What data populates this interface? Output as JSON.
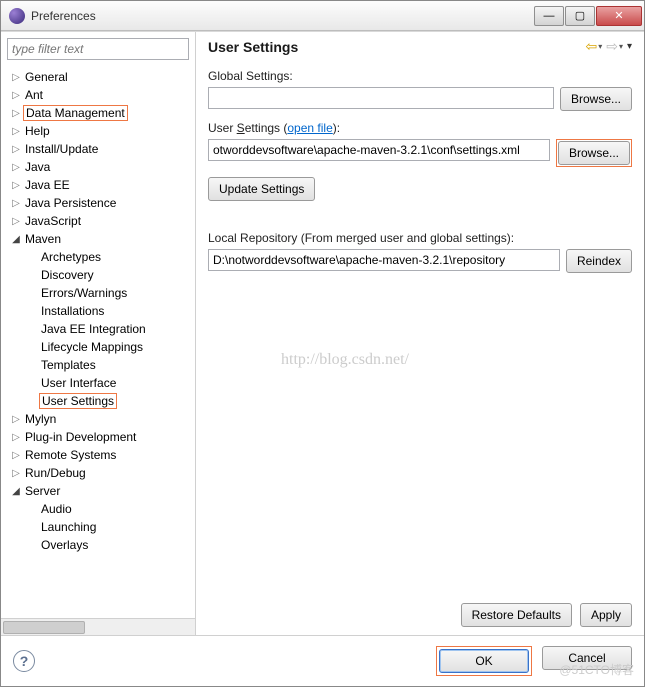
{
  "window": {
    "title": "Preferences"
  },
  "sidebar": {
    "filter_placeholder": "type filter text",
    "items": [
      {
        "label": "General",
        "expandable": true,
        "open": false,
        "level": 0
      },
      {
        "label": "Ant",
        "expandable": true,
        "open": false,
        "level": 0
      },
      {
        "label": "Data Management",
        "expandable": true,
        "open": false,
        "level": 0,
        "highlight": true
      },
      {
        "label": "Help",
        "expandable": true,
        "open": false,
        "level": 0
      },
      {
        "label": "Install/Update",
        "expandable": true,
        "open": false,
        "level": 0
      },
      {
        "label": "Java",
        "expandable": true,
        "open": false,
        "level": 0
      },
      {
        "label": "Java EE",
        "expandable": true,
        "open": false,
        "level": 0
      },
      {
        "label": "Java Persistence",
        "expandable": true,
        "open": false,
        "level": 0
      },
      {
        "label": "JavaScript",
        "expandable": true,
        "open": false,
        "level": 0
      },
      {
        "label": "Maven",
        "expandable": true,
        "open": true,
        "level": 0
      },
      {
        "label": "Archetypes",
        "expandable": false,
        "level": 1
      },
      {
        "label": "Discovery",
        "expandable": false,
        "level": 1
      },
      {
        "label": "Errors/Warnings",
        "expandable": false,
        "level": 1
      },
      {
        "label": "Installations",
        "expandable": false,
        "level": 1
      },
      {
        "label": "Java EE Integration",
        "expandable": false,
        "level": 1
      },
      {
        "label": "Lifecycle Mappings",
        "expandable": false,
        "level": 1
      },
      {
        "label": "Templates",
        "expandable": false,
        "level": 1
      },
      {
        "label": "User Interface",
        "expandable": false,
        "level": 1
      },
      {
        "label": "User Settings",
        "expandable": false,
        "level": 1,
        "highlight": true
      },
      {
        "label": "Mylyn",
        "expandable": true,
        "open": false,
        "level": 0
      },
      {
        "label": "Plug-in Development",
        "expandable": true,
        "open": false,
        "level": 0
      },
      {
        "label": "Remote Systems",
        "expandable": true,
        "open": false,
        "level": 0
      },
      {
        "label": "Run/Debug",
        "expandable": true,
        "open": false,
        "level": 0
      },
      {
        "label": "Server",
        "expandable": true,
        "open": true,
        "level": 0
      },
      {
        "label": "Audio",
        "expandable": false,
        "level": 1
      },
      {
        "label": "Launching",
        "expandable": false,
        "level": 1
      },
      {
        "label": "Overlays",
        "expandable": false,
        "level": 1
      }
    ]
  },
  "main": {
    "title": "User Settings",
    "global_label": "Global Settings:",
    "global_value": "",
    "browse": "Browse...",
    "user_label_pre": "User ",
    "user_label_u": "S",
    "user_label_post": "ettings (",
    "open_file": "open file",
    "user_label_end": "):",
    "user_value": "otworddevsoftware\\apache-maven-3.2.1\\conf\\settings.xml",
    "update_btn": "Update Settings",
    "repo_label": "Local Repository (From merged user and global settings):",
    "repo_value": "D:\\notworddevsoftware\\apache-maven-3.2.1\\repository",
    "reindex": "Reindex",
    "restore": "Restore Defaults",
    "apply": "Apply"
  },
  "footer": {
    "ok": "OK",
    "cancel": "Cancel"
  },
  "watermark": "http://blog.csdn.net/",
  "watermark2": "@51CTO博客"
}
